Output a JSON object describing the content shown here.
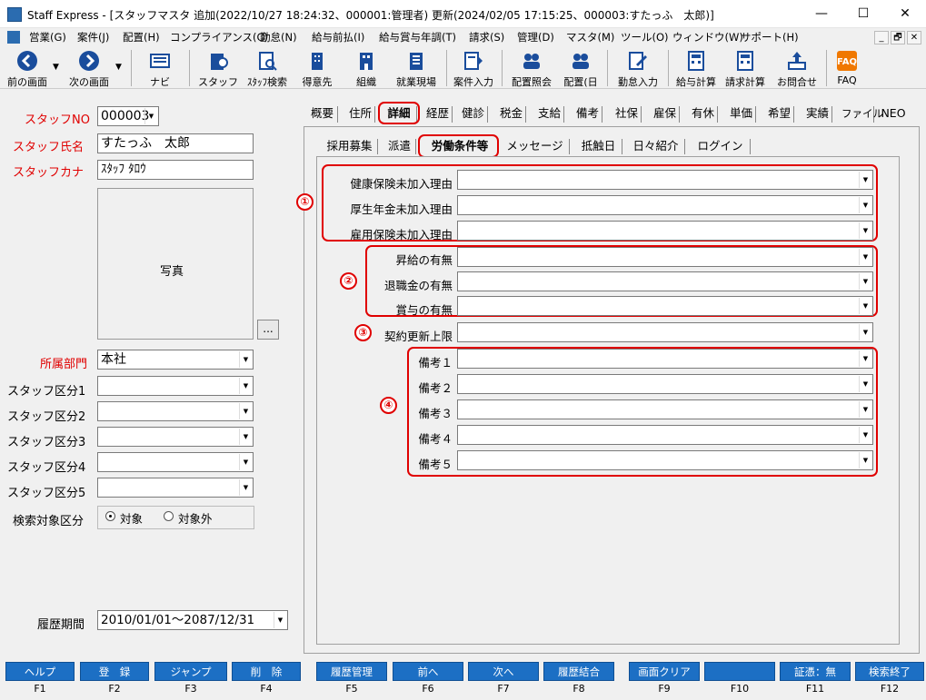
{
  "window": {
    "title": "Staff Express - [スタッフマスタ  追加(2022/10/27 18:24:32、000001:管理者)  更新(2024/02/05 17:15:25、000003:すたっふ　太郎)]",
    "min": "—",
    "max": "☐",
    "close": "✕"
  },
  "menu": [
    "営業(G)",
    "案件(J)",
    "配置(H)",
    "コンプライアンス(C)",
    "勤怠(N)",
    "給与前払(I)",
    "給与賞与年調(T)",
    "請求(S)",
    "管理(D)",
    "マスタ(M)",
    "ツール(O)",
    "ウィンドウ(W)",
    "サポート(H)"
  ],
  "mdi": [
    "_",
    "🗗",
    "✕"
  ],
  "toolbar": [
    "前の画面",
    "次の画面",
    "ナビ",
    "スタッフ",
    "ｽﾀｯﾌ検索",
    "得意先",
    "組織",
    "就業現場",
    "案件入力",
    "配置照会",
    "配置(日",
    "勤怠入力",
    "給与計算",
    "請求計算",
    "お問合せ",
    "FAQ"
  ],
  "left": {
    "staff_no_label": "スタッフNO",
    "staff_no": "000003",
    "name_label": "スタッフ氏名",
    "name": "すたっふ　太郎",
    "kana_label": "スタッフカナ",
    "kana": "ｽﾀｯﾌ ﾀﾛｳ",
    "photo_label": "写真",
    "photo_btn": "...",
    "dept_label": "所属部門",
    "dept": "本社",
    "kubun": [
      "スタッフ区分1",
      "スタッフ区分2",
      "スタッフ区分3",
      "スタッフ区分4",
      "スタッフ区分5"
    ],
    "search_label": "検索対象区分",
    "opt_on": "対象",
    "opt_off": "対象外",
    "period_label": "履歴期間",
    "period": "2010/01/01〜2087/12/31"
  },
  "tabs": [
    "概要",
    "住所",
    "詳細",
    "経歴",
    "健診",
    "税金",
    "支給",
    "備考",
    "社保",
    "雇保",
    "有休",
    "単価",
    "希望",
    "実績",
    "ファイル",
    "NEO"
  ],
  "subtabs": [
    "採用募集",
    "派遣",
    "労働条件等",
    "メッセージ",
    "抵触日",
    "日々紹介",
    "ログイン"
  ],
  "groups": {
    "g1": {
      "num": "①",
      "rows": [
        "健康保険未加入理由",
        "厚生年金未加入理由",
        "雇用保険未加入理由"
      ]
    },
    "g2": {
      "num": "②",
      "rows": [
        "昇給の有無",
        "退職金の有無",
        "賞与の有無"
      ]
    },
    "g3": {
      "num": "③",
      "rows": [
        "契約更新上限"
      ]
    },
    "g4": {
      "num": "④",
      "rows": [
        "備考１",
        "備考２",
        "備考３",
        "備考４",
        "備考５"
      ]
    }
  },
  "fkeys": [
    {
      "label": "ヘルプ",
      "key": "F1"
    },
    {
      "label": "登　録",
      "key": "F2"
    },
    {
      "label": "ジャンプ",
      "key": "F3"
    },
    {
      "label": "削　除",
      "key": "F4"
    },
    {
      "label": "履歴管理",
      "key": "F5"
    },
    {
      "label": "前へ",
      "key": "F6"
    },
    {
      "label": "次へ",
      "key": "F7"
    },
    {
      "label": "履歴結合",
      "key": "F8"
    },
    {
      "label": "画面クリア",
      "key": "F9"
    },
    {
      "label": "",
      "key": "F10"
    },
    {
      "label": "証憑：無",
      "key": "F11"
    },
    {
      "label": "検索終了",
      "key": "F12"
    }
  ],
  "colors": {
    "accent_red": "#e00000",
    "fkey_blue": "#1c6fc4",
    "icon_blue": "#2b6cb0"
  }
}
